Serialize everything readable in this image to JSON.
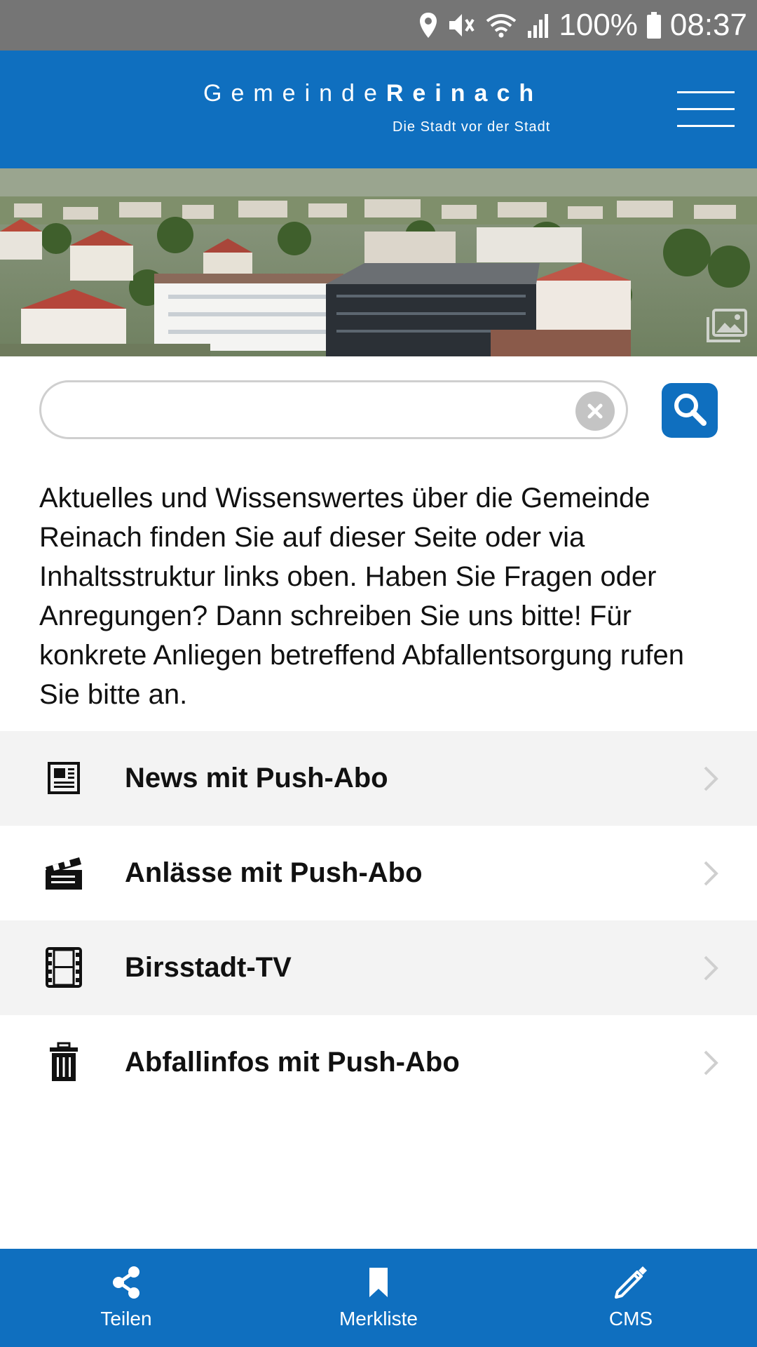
{
  "status_bar": {
    "battery": "100%",
    "time": "08:37",
    "icons": [
      "location-icon",
      "mute-icon",
      "wifi-icon",
      "signal-icon",
      "battery-icon"
    ]
  },
  "header": {
    "logo_part1": "Gemeinde",
    "logo_part2": "Reinach",
    "logo_tagline": "Die Stadt vor der Stadt",
    "menu_icon": "hamburger-menu-icon",
    "background_color": "#0f6fbf"
  },
  "hero": {
    "description_icon": "image-gallery-icon"
  },
  "search": {
    "value": "",
    "placeholder": "",
    "clear_icon": "clear-icon",
    "search_icon": "search-icon"
  },
  "intro": {
    "text": "Aktuelles und Wissenswertes über die Gemeinde Reinach finden Sie auf dieser Seite oder via Inhaltsstruktur links oben. Haben Sie Fragen oder Anregungen? Dann schreiben Sie uns bitte! Für konkrete Anliegen betreffend Abfallentsorgung rufen Sie bitte an."
  },
  "menu": {
    "items": [
      {
        "label": "News mit Push-Abo",
        "icon": "newspaper-icon"
      },
      {
        "label": "Anlässe mit Push-Abo",
        "icon": "clapperboard-icon"
      },
      {
        "label": "Birsstadt-TV",
        "icon": "film-icon"
      },
      {
        "label": "Abfallinfos mit Push-Abo",
        "icon": "trash-icon"
      }
    ]
  },
  "bottom_nav": {
    "items": [
      {
        "label": "Teilen",
        "icon": "share-icon"
      },
      {
        "label": "Merkliste",
        "icon": "bookmark-icon"
      },
      {
        "label": "CMS",
        "icon": "pencil-icon"
      }
    ]
  },
  "colors": {
    "brand_blue": "#0f6fbf",
    "status_bar": "#757575",
    "row_shade": "#f3f3f3"
  }
}
